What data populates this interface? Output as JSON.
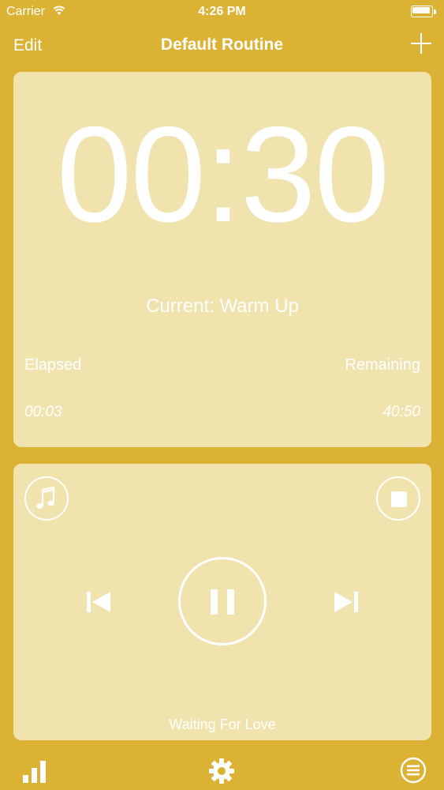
{
  "status_bar": {
    "carrier": "Carrier",
    "time": "4:26 PM"
  },
  "nav": {
    "edit_label": "Edit",
    "title": "Default Routine",
    "add_icon": "plus-icon"
  },
  "timer": {
    "countdown": "00:30",
    "current": "Current: Warm Up",
    "elapsed_label": "Elapsed",
    "remaining_label": "Remaining",
    "elapsed_value": "00:03",
    "remaining_value": "40:50"
  },
  "player": {
    "song": "Waiting For Love",
    "icons": [
      "music-note-icon",
      "stop-icon",
      "previous-icon",
      "pause-icon",
      "next-icon"
    ]
  },
  "tab_bar": {
    "icons": [
      "bar-chart-icon",
      "gear-icon",
      "list-icon"
    ]
  },
  "colors": {
    "background": "#DBB234",
    "card": "#F0E3AE",
    "foreground": "#FFFFFF"
  }
}
